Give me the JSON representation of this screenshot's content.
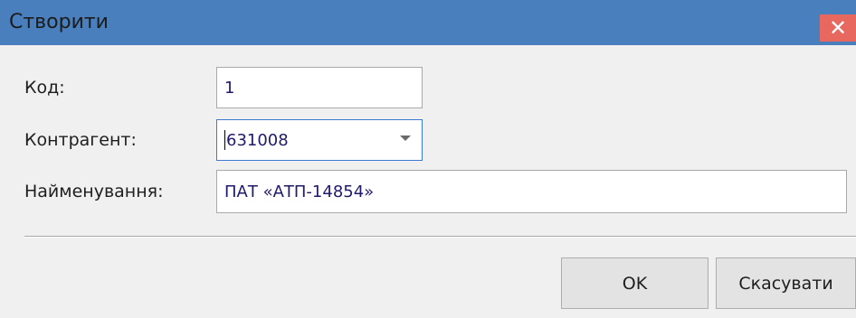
{
  "dialog": {
    "title": "Створити",
    "close_label": "✕"
  },
  "form": {
    "code": {
      "label": "Код:",
      "value": "1"
    },
    "counterparty": {
      "label": "Контрагент:",
      "value": "631008"
    },
    "name": {
      "label": "Найменування:",
      "value": "ПАТ «АТП-14854»"
    }
  },
  "buttons": {
    "ok": "OK",
    "cancel": "Скасувати"
  }
}
